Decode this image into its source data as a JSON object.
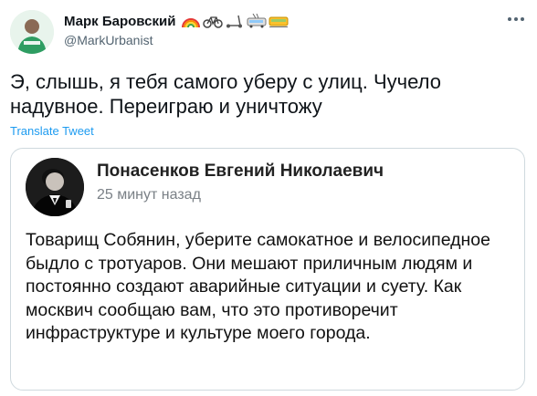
{
  "author": {
    "display_name": "Марк Баровский",
    "handle": "@MarkUrbanist",
    "name_emojis": [
      "rainbow-icon",
      "bicycle-icon",
      "kick-scooter-icon",
      "trolleybus-icon",
      "tram-icon"
    ]
  },
  "tweet": {
    "text": "Э, слышь, я тебя самого уберу с улиц. Чучело надувное. Переиграю и уничтожу",
    "translate_label": "Translate Tweet"
  },
  "quoted_post": {
    "author_name": "Понасенков Евгений Николаевич",
    "timestamp": "25 минут назад",
    "text": "Товарищ Собянин, уберите самокатное и велосипедное быдло с тротуаров. Они мешают приличным людям и постоянно создают аварийные ситуации и суету. Как москвич сообщаю вам, что это противоречит инфраструктуре и культуре моего города."
  },
  "colors": {
    "link": "#1d9bf0",
    "secondary_text": "#536471",
    "border": "#cfd9de"
  }
}
